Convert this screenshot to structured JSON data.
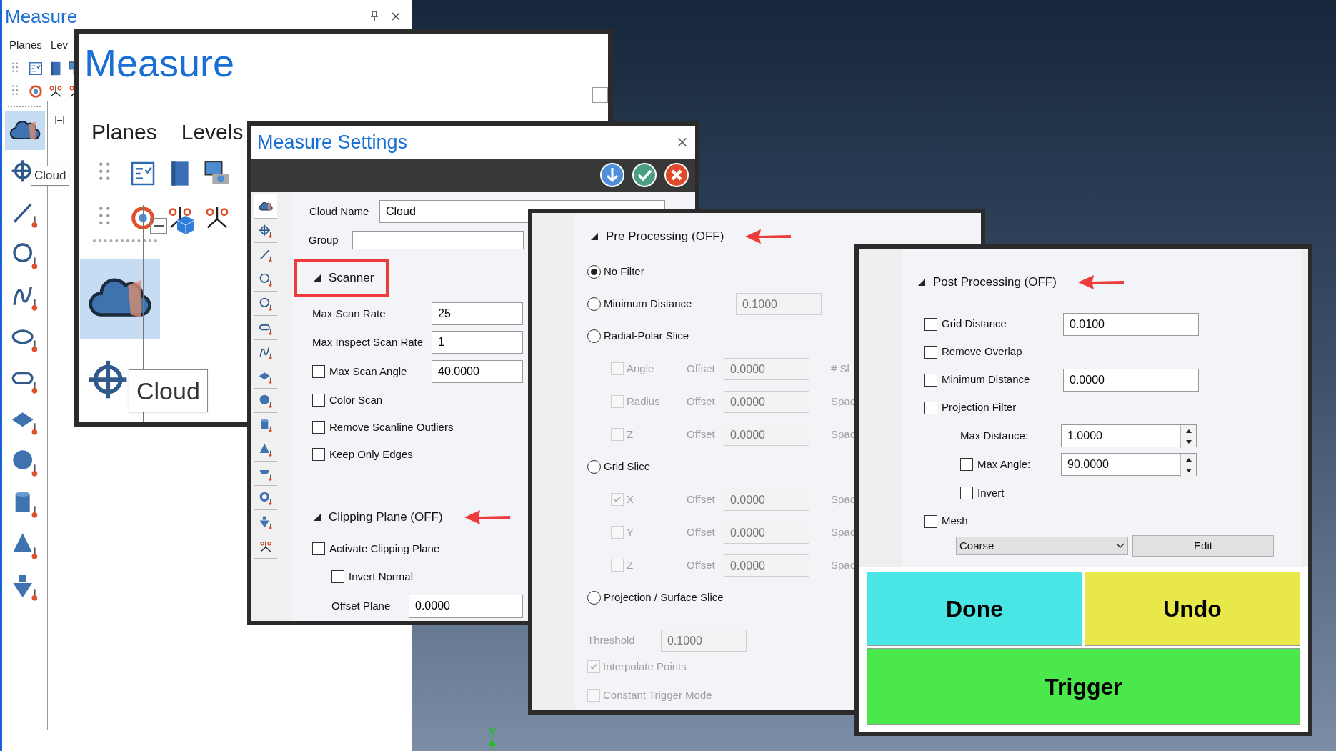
{
  "dock": {
    "title": "Measure",
    "menu": [
      "Planes",
      "Lev"
    ],
    "tooltip": "Cloud",
    "tools": [
      {
        "selected": true
      },
      {
        "selected": false
      },
      {
        "selected": false
      },
      {
        "selected": false
      },
      {
        "selected": false
      },
      {
        "selected": false
      },
      {
        "selected": false
      },
      {
        "selected": false
      },
      {
        "selected": false
      },
      {
        "selected": false
      },
      {
        "selected": false
      },
      {
        "selected": false
      }
    ]
  },
  "zoom_window": {
    "title": "Measure",
    "menu": [
      "Planes",
      "Levels"
    ],
    "tooltip": "Cloud",
    "cloud_tool": {
      "selected": true
    }
  },
  "settings": {
    "title": "Measure Settings",
    "tools": [
      {
        "selected": true
      },
      {
        "selected": false
      },
      {
        "selected": false
      },
      {
        "selected": false
      },
      {
        "selected": false
      },
      {
        "selected": false
      },
      {
        "selected": false
      },
      {
        "selected": false
      },
      {
        "selected": false
      },
      {
        "selected": false
      },
      {
        "selected": false
      },
      {
        "selected": false
      },
      {
        "selected": false
      },
      {
        "selected": false
      },
      {
        "selected": false
      }
    ],
    "cloud_name": {
      "label": "Cloud Name",
      "value": "Cloud"
    },
    "group": {
      "label": "Group"
    },
    "scanner": {
      "title": "Scanner",
      "expanded": true,
      "highlighted": true,
      "rows": [
        {
          "kind": "field",
          "label": "Max Scan Rate",
          "value": "25"
        },
        {
          "kind": "field",
          "label": "Max Inspect Scan Rate",
          "value": "1"
        },
        {
          "kind": "check_field",
          "label": "Max Scan Angle",
          "checked": false,
          "value": "40.0000"
        },
        {
          "kind": "check",
          "label": "Color Scan",
          "checked": false
        },
        {
          "kind": "check",
          "label": "Remove Scanline Outliers",
          "checked": false
        },
        {
          "kind": "check",
          "label": "Keep Only Edges",
          "checked": false
        }
      ]
    },
    "clipping": {
      "title": "Clipping Plane (OFF)",
      "expanded": true,
      "rows": [
        {
          "kind": "check",
          "label": "Activate Clipping Plane",
          "checked": false
        },
        {
          "kind": "subcheck",
          "label": "Invert Normal",
          "checked": false
        },
        {
          "kind": "subfield",
          "label": "Offset Plane",
          "value": "0.0000"
        }
      ]
    }
  },
  "pre_processing": {
    "title": "Pre Processing (OFF)",
    "expanded": true,
    "options": [
      {
        "label": "No Filter",
        "selected": true
      },
      {
        "label": "Minimum Distance",
        "selected": false,
        "value": "0.1000"
      },
      {
        "label": "Radial-Polar Slice",
        "selected": false,
        "children": [
          {
            "label": "Angle",
            "checked": false,
            "offset_label": "Offset",
            "value": "0.0000",
            "extra": "# Sl"
          },
          {
            "label": "Radius",
            "checked": false,
            "offset_label": "Offset",
            "value": "0.0000",
            "extra": "Spac"
          },
          {
            "label": "Z",
            "checked": false,
            "offset_label": "Offset",
            "value": "0.0000",
            "extra": "Spac"
          }
        ]
      },
      {
        "label": "Grid Slice",
        "selected": false,
        "children": [
          {
            "label": "X",
            "checked": true,
            "offset_label": "Offset",
            "value": "0.0000",
            "extra": "Spac"
          },
          {
            "label": "Y",
            "checked": false,
            "offset_label": "Offset",
            "value": "0.0000",
            "extra": "Spac"
          },
          {
            "label": "Z",
            "checked": false,
            "offset_label": "Offset",
            "value": "0.0000",
            "extra": "Spac"
          }
        ]
      },
      {
        "label": "Projection / Surface Slice",
        "selected": false
      }
    ],
    "threshold": {
      "label": "Threshold",
      "value": "0.1000",
      "disabled": true
    },
    "checks": [
      {
        "label": "Interpolate Points",
        "checked": true,
        "disabled": true
      },
      {
        "label": "Constant Trigger Mode",
        "checked": false,
        "disabled": true
      }
    ]
  },
  "post_processing": {
    "title": "Post Processing (OFF)",
    "expanded": true,
    "rows": [
      {
        "kind": "check_field",
        "label": "Grid Distance",
        "checked": false,
        "value": "0.0100"
      },
      {
        "kind": "check",
        "label": "Remove Overlap",
        "checked": false
      },
      {
        "kind": "check_field",
        "label": "Minimum Distance",
        "checked": false,
        "value": "0.0000"
      },
      {
        "kind": "check",
        "label": "Projection Filter",
        "checked": false
      },
      {
        "kind": "spin",
        "label": "Max Distance:",
        "value": "1.0000"
      },
      {
        "kind": "check_spin",
        "label": "Max Angle:",
        "checked": false,
        "value": "90.0000"
      },
      {
        "kind": "subcheck",
        "label": "Invert",
        "checked": false
      },
      {
        "kind": "check",
        "label": "Mesh",
        "checked": false
      }
    ],
    "mesh_select": "Coarse",
    "edit_button": "Edit",
    "actions": [
      {
        "label": "Done",
        "color": "#4ae6e6"
      },
      {
        "label": "Undo",
        "color": "#e8e84a"
      },
      {
        "label": "Trigger",
        "color": "#4ae84a"
      }
    ]
  },
  "axis_label": "Y"
}
